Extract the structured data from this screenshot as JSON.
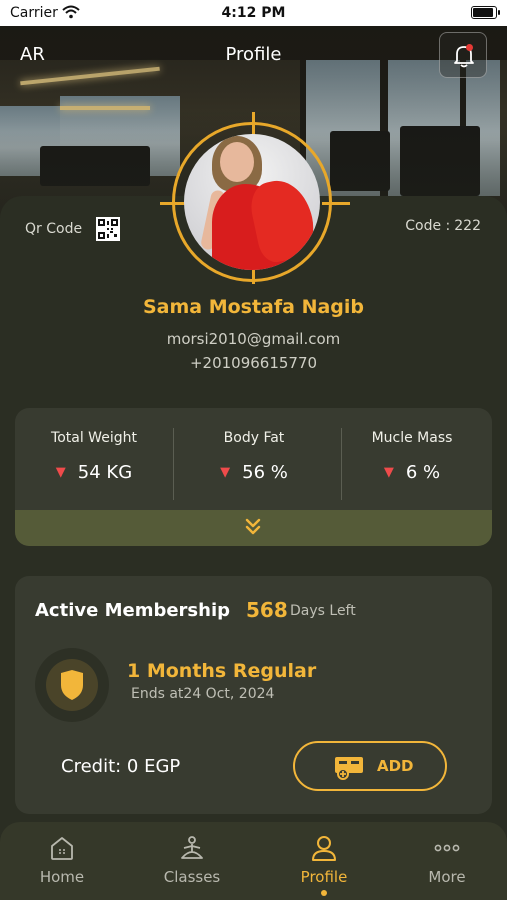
{
  "status_bar": {
    "carrier": "Carrier",
    "time": "4:12 PM"
  },
  "header": {
    "language": "AR",
    "title": "Profile"
  },
  "profile": {
    "qr_label": "Qr Code",
    "code_label": "Code :",
    "code_value": "222",
    "name": "Sama Mostafa Nagib",
    "email": "morsi2010@gmail.com",
    "phone": "+201096615770"
  },
  "stats": [
    {
      "label": "Total Weight",
      "value": "54 KG",
      "trend": "down"
    },
    {
      "label": "Body Fat",
      "value": "56 %",
      "trend": "down"
    },
    {
      "label": "Mucle Mass",
      "value": "6 %",
      "trend": "down"
    }
  ],
  "membership": {
    "title": "Active Membership",
    "days_left": "568",
    "days_left_label": "Days Left",
    "plan_name": "1 Months Regular",
    "ends": "Ends at24 Oct, 2024",
    "credit": "Credit: 0 EGP",
    "add_label": "ADD"
  },
  "nav": {
    "items": [
      {
        "label": "Home",
        "icon": "home-icon"
      },
      {
        "label": "Classes",
        "icon": "yoga-icon"
      },
      {
        "label": "Profile",
        "icon": "user-icon"
      },
      {
        "label": "More",
        "icon": "more-icon"
      }
    ],
    "active_index": 2
  },
  "colors": {
    "accent": "#f2b63a",
    "background": "#2a2d22",
    "card": "#383b30",
    "trend_down": "#ef4b4b"
  }
}
